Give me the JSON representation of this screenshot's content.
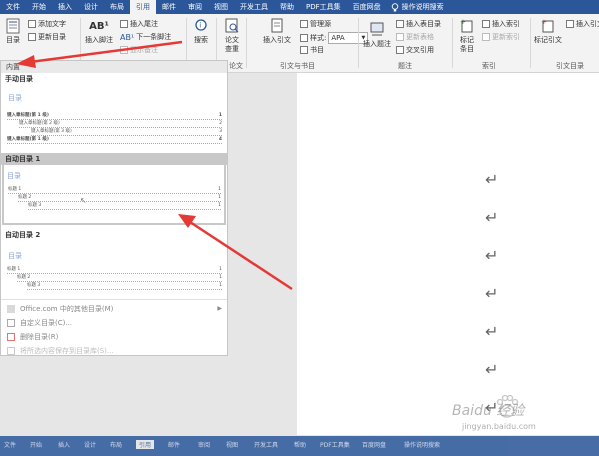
{
  "tabs": [
    "文件",
    "开始",
    "插入",
    "设计",
    "布局",
    "引用",
    "邮件",
    "审阅",
    "视图",
    "开发工具",
    "帮助",
    "PDF工具集",
    "百度网盘"
  ],
  "active_tab_index": 5,
  "tell_me": "操作说明搜索",
  "ribbon": {
    "toc_button": "目录",
    "add_text": "添加文字",
    "update_toc": "更新目录",
    "ab_button_glyph": "AB¹",
    "insert_footnote": "插入脚注",
    "insert_endnote": "插入尾注",
    "next_footnote": "下一条脚注",
    "show_notes": "显示备注",
    "search": "搜索",
    "paper_check": "论文查重",
    "paper_group": "论文",
    "insert_citation": "插入引文",
    "manage_sources": "管理源",
    "style_label": "样式:",
    "style_value": "APA",
    "bibliography": "书目",
    "citations_group": "引文与书目",
    "insert_caption": "插入题注",
    "insert_table_of_figures": "插入表目录",
    "update_table": "更新表格",
    "cross_reference": "交叉引用",
    "captions_group": "题注",
    "mark_entry": "标记条目",
    "insert_index": "插入索引",
    "update_index": "更新索引",
    "index_group": "索引",
    "mark_citation": "标记引文",
    "insert_toa": "插入引文目录",
    "toa_group": "引文目录"
  },
  "toc_dropdown": {
    "header": "内置",
    "manual_title": "手动目录",
    "manual_preview_label": "目录",
    "manual_lines": [
      {
        "text": "键入章标题(第 1 级)",
        "page": "1"
      },
      {
        "text": "键入章标题(第 2 级)",
        "page": "2"
      },
      {
        "text": "键入章标题(第 3 级)",
        "page": "3"
      },
      {
        "text": "键入章标题(第 1 级)",
        "page": "4"
      }
    ],
    "auto1_title": "自动目录 1",
    "auto1_preview_label": "目录",
    "auto1_lines": [
      {
        "text": "标题 1",
        "page": "1"
      },
      {
        "text": "标题 2",
        "page": "1"
      },
      {
        "text": "标题 3",
        "page": "1"
      }
    ],
    "auto2_title": "自动目录 2",
    "auto2_preview_label": "目录",
    "auto2_lines": [
      {
        "text": "标题 1",
        "page": "1"
      },
      {
        "text": "标题 2",
        "page": "1"
      },
      {
        "text": "标题 3",
        "page": "1"
      }
    ],
    "menu": [
      "Office.com 中的其他目录(M)",
      "自定义目录(C)...",
      "删除目录(R)",
      "将所选内容保存到目录库(S)..."
    ]
  },
  "document": {
    "paragraph_mark": "↵",
    "mark_count": 7
  },
  "statusbar_tabs": [
    "文件",
    "开始",
    "插入",
    "设计",
    "布局",
    "引用",
    "邮件",
    "审阅",
    "视图",
    "开发工具",
    "帮助",
    "PDF工具集",
    "百度网盘",
    "操作说明搜索"
  ],
  "watermark": {
    "text": "Baidu 经验",
    "url": "jingyan.baidu.com"
  },
  "colors": {
    "ribbon_blue": "#2b579a",
    "arrow_red": "#e53935",
    "preview_label_blue": "#8aa6d8"
  }
}
